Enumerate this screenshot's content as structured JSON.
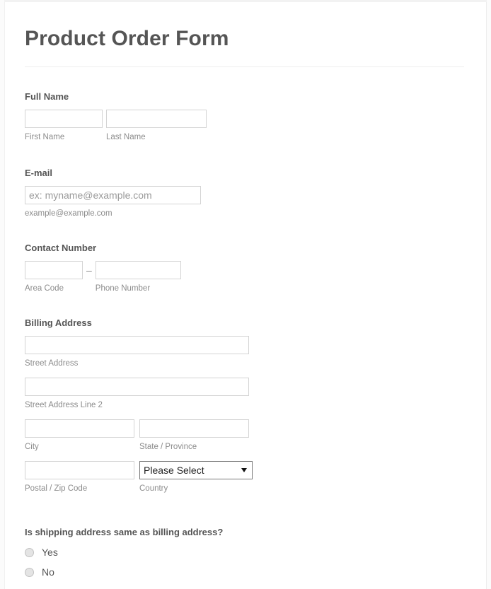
{
  "form": {
    "title": "Product Order Form",
    "sections": {
      "full_name": {
        "label": "Full Name",
        "first": {
          "value": "",
          "placeholder": "",
          "hint": "First Name"
        },
        "last": {
          "value": "",
          "placeholder": "",
          "hint": "Last Name"
        }
      },
      "email": {
        "label": "E-mail",
        "input": {
          "value": "",
          "placeholder": "ex: myname@example.com",
          "hint": "example@example.com"
        }
      },
      "contact_number": {
        "label": "Contact Number",
        "separator": "–",
        "area_code": {
          "value": "",
          "placeholder": "",
          "hint": "Area Code"
        },
        "phone_number": {
          "value": "",
          "placeholder": "",
          "hint": "Phone Number"
        }
      },
      "billing_address": {
        "label": "Billing Address",
        "street": {
          "value": "",
          "placeholder": "",
          "hint": "Street Address"
        },
        "street2": {
          "value": "",
          "placeholder": "",
          "hint": "Street Address Line 2"
        },
        "city": {
          "value": "",
          "placeholder": "",
          "hint": "City"
        },
        "state": {
          "value": "",
          "placeholder": "",
          "hint": "State / Province"
        },
        "postal": {
          "value": "",
          "placeholder": "",
          "hint": "Postal / Zip Code"
        },
        "country": {
          "selected": "Please Select",
          "hint": "Country",
          "options": [
            "Please Select"
          ]
        }
      },
      "shipping_same": {
        "question": "Is shipping address same as billing address?",
        "options": [
          {
            "label": "Yes",
            "checked": false
          },
          {
            "label": "No",
            "checked": false
          }
        ]
      }
    }
  },
  "colors": {
    "title": "#555555",
    "label": "#555555",
    "hint": "#8c8c8c",
    "input_border": "#d4d4d4",
    "select_border": "#777777",
    "rule": "#eeeeee",
    "background": "#ffffff"
  }
}
